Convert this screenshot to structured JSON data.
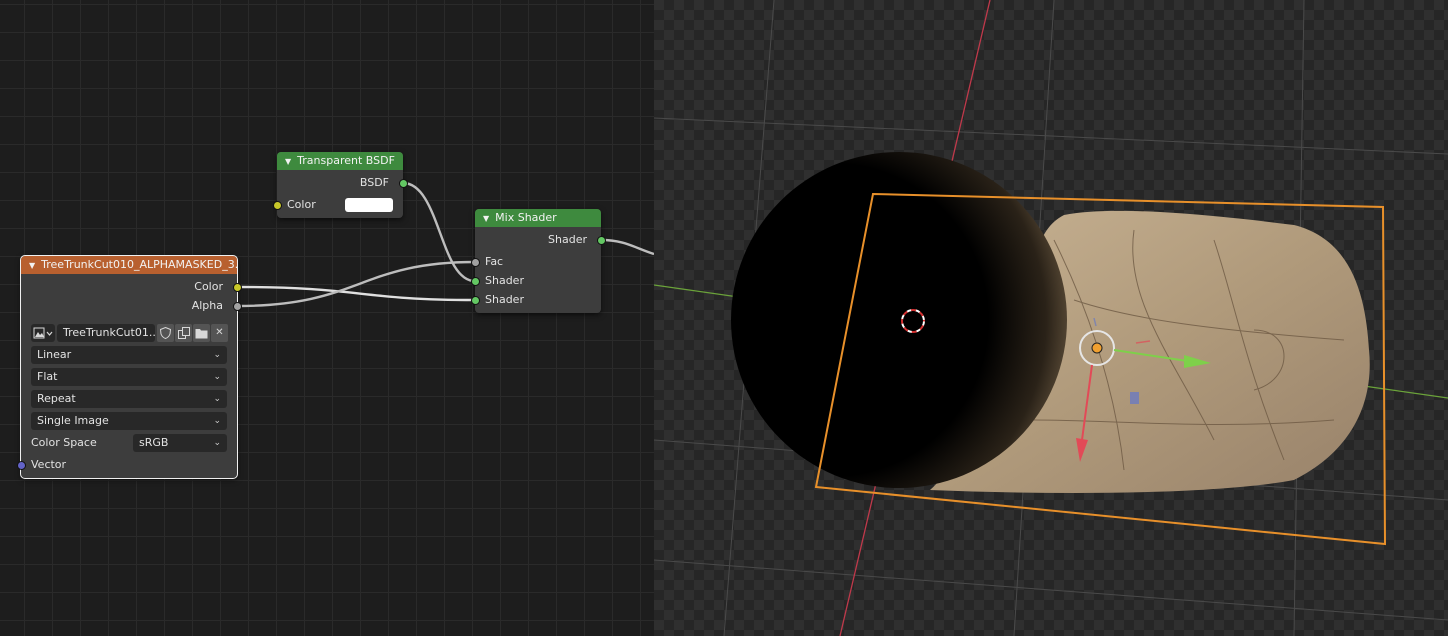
{
  "node_editor": {
    "image_node": {
      "title": "TreeTrunkCut010_ALPHAMASKED_3...",
      "outputs": [
        "Color",
        "Alpha"
      ],
      "image_name": "TreeTrunkCut01...",
      "interpolation": "Linear",
      "projection": "Flat",
      "extension": "Repeat",
      "source": "Single Image",
      "color_space_label": "Color Space",
      "color_space": "sRGB",
      "vector_input": "Vector",
      "header_color": "#b8602f"
    },
    "transparent_node": {
      "title": "Transparent BSDF",
      "output": "BSDF",
      "color_input": "Color",
      "color_value": "#ffffff",
      "header_color": "#3e8a3e"
    },
    "mix_node": {
      "title": "Mix Shader",
      "output": "Shader",
      "inputs": [
        "Fac",
        "Shader",
        "Shader"
      ],
      "header_color": "#3e8a3e"
    }
  },
  "viewport": {
    "selection_color": "#e8902a",
    "x_axis_color": "#c0394b",
    "y_axis_color": "#6ba33a"
  }
}
